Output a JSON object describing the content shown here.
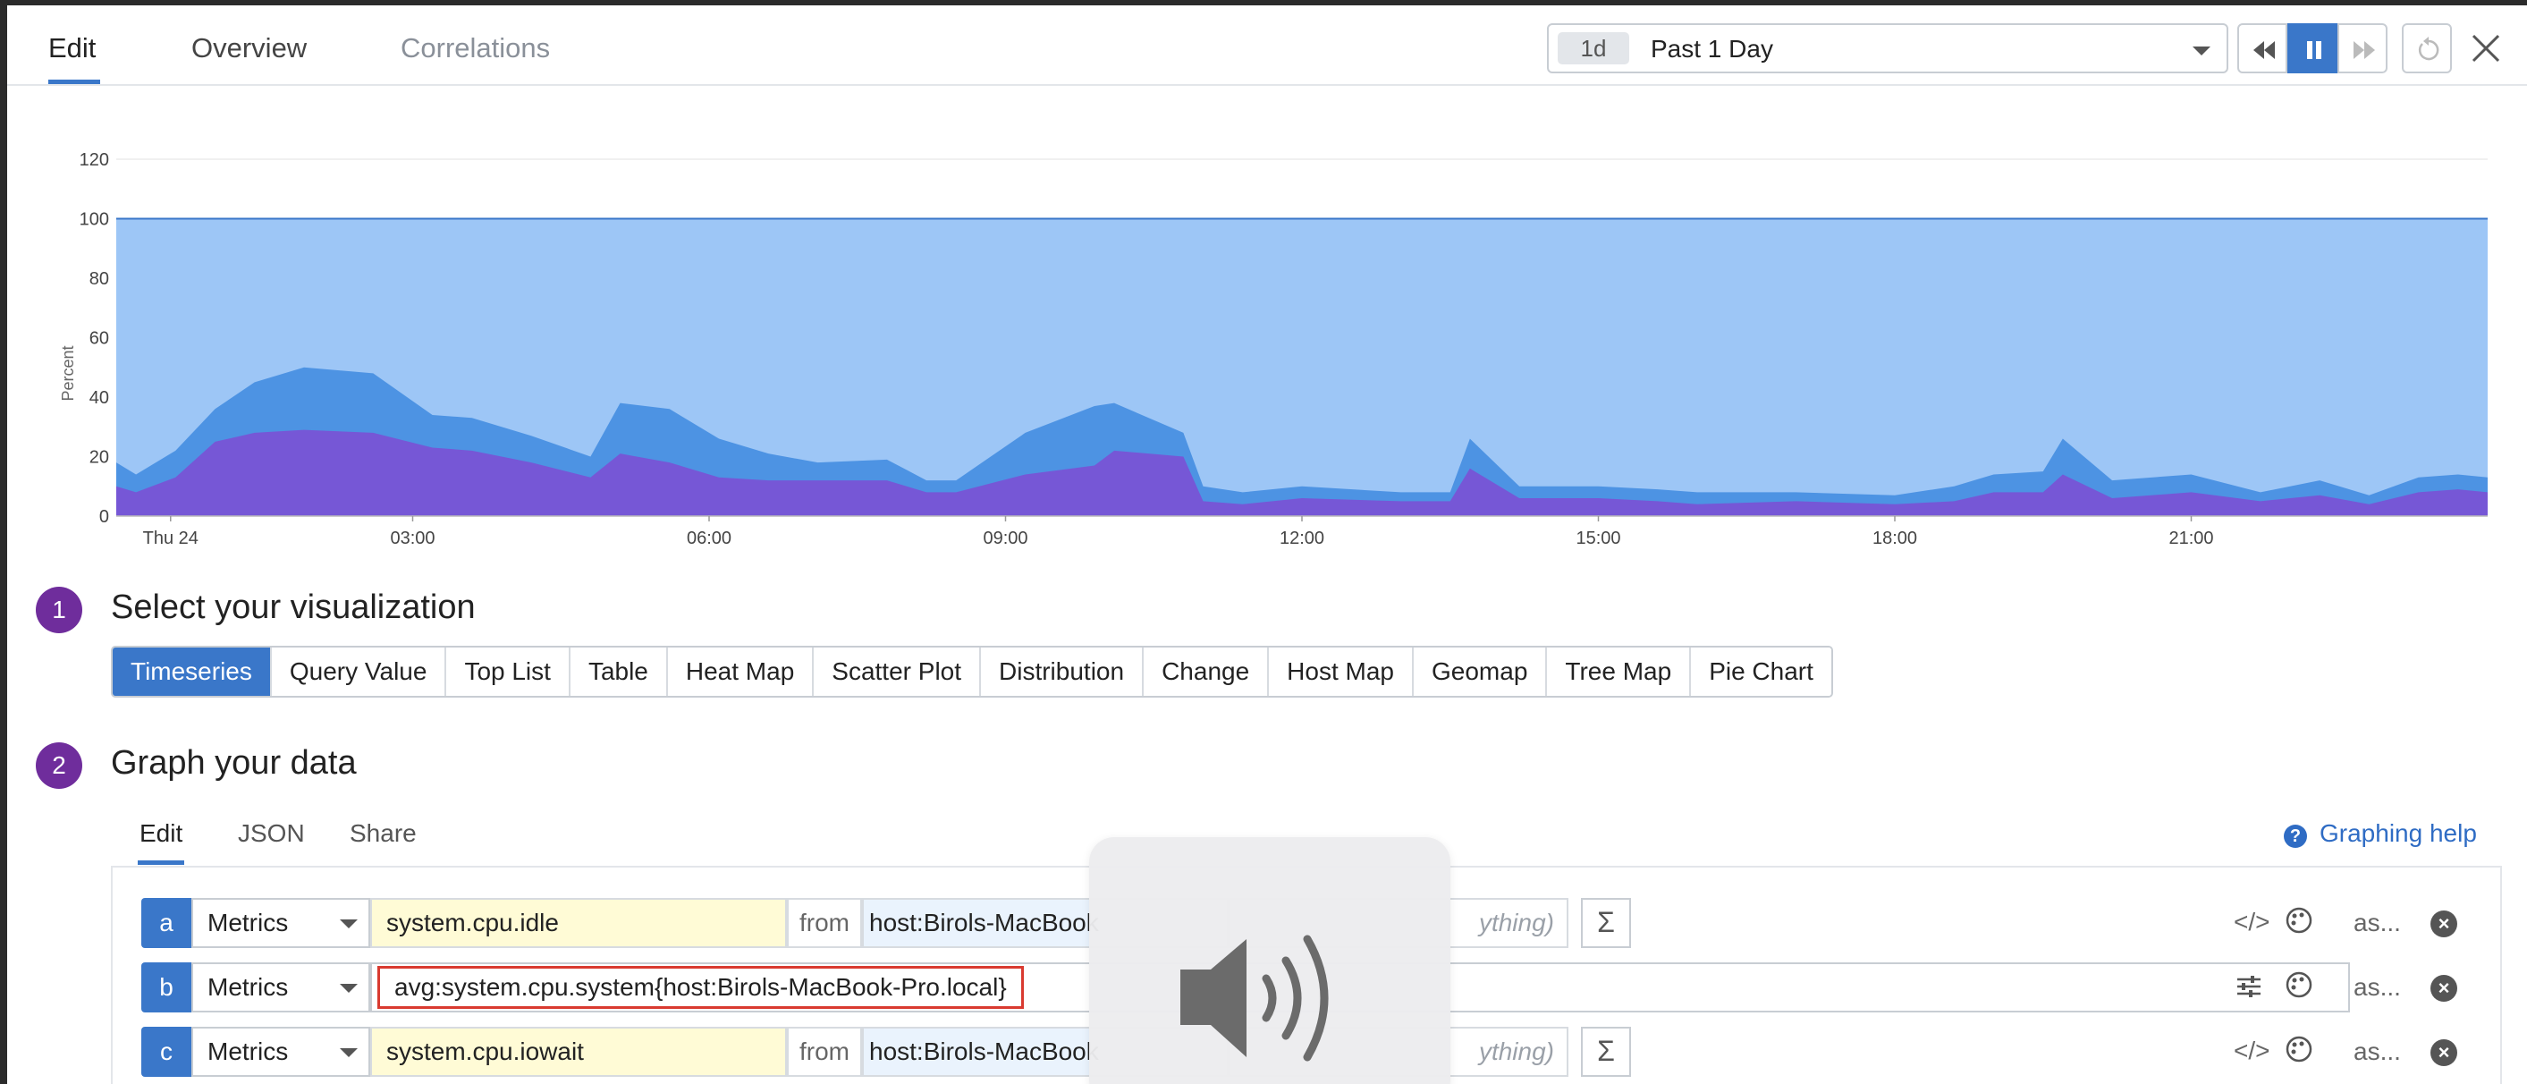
{
  "header": {
    "tabs": [
      {
        "label": "Edit",
        "active": true
      },
      {
        "label": "Overview",
        "active": false
      },
      {
        "label": "Correlations",
        "active": false
      }
    ],
    "timerange": {
      "badge": "1d",
      "label": "Past 1 Day"
    },
    "controls": [
      "rewind-icon",
      "pause-icon",
      "fast-forward-icon",
      "reset-icon",
      "close-icon"
    ]
  },
  "chart_data": {
    "type": "area",
    "ylabel": "Percent",
    "ylim": [
      0,
      120
    ],
    "yticks": [
      "0",
      "20",
      "40",
      "60",
      "80",
      "100",
      "120"
    ],
    "xticks": [
      "Thu 24",
      "03:00",
      "06:00",
      "09:00",
      "12:00",
      "15:00",
      "18:00",
      "21:00"
    ],
    "xlim_hours": [
      0,
      24
    ],
    "series": [
      {
        "color": "#9dc6f6",
        "values": [
          100,
          100,
          100,
          100,
          100,
          100,
          100,
          100,
          100,
          100,
          100,
          100,
          100,
          100,
          100,
          100,
          100,
          100,
          100,
          100,
          100,
          100,
          100,
          100
        ]
      },
      {
        "color": "#4d93e3",
        "x": [
          0,
          0.2,
          0.6,
          1.0,
          1.4,
          1.9,
          2.6,
          3.2,
          3.6,
          4.2,
          4.8,
          5.1,
          5.6,
          6.1,
          6.6,
          7.1,
          7.8,
          8.2,
          8.5,
          9.2,
          9.9,
          10.1,
          10.8,
          11.0,
          11.4,
          12.0,
          13.0,
          13.5,
          13.7,
          14.2,
          15.0,
          15.6,
          16.0,
          17.0,
          18.0,
          18.6,
          19.0,
          19.5,
          19.7,
          20.2,
          21.0,
          21.7,
          22.3,
          22.8,
          23.3,
          23.7,
          24.0
        ],
        "values": [
          18,
          14,
          22,
          36,
          45,
          50,
          48,
          34,
          33,
          27,
          20,
          38,
          36,
          26,
          21,
          18,
          19,
          12,
          12,
          28,
          37,
          38,
          28,
          10,
          8,
          10,
          8,
          8,
          26,
          10,
          10,
          9,
          8,
          8,
          7,
          10,
          14,
          15,
          26,
          12,
          14,
          8,
          12,
          7,
          13,
          14,
          13
        ]
      },
      {
        "color": "#7657d6",
        "x": [
          0,
          0.2,
          0.6,
          1.0,
          1.4,
          1.9,
          2.6,
          3.2,
          3.6,
          4.2,
          4.8,
          5.1,
          5.6,
          6.1,
          6.6,
          7.1,
          7.8,
          8.2,
          8.5,
          9.2,
          9.9,
          10.1,
          10.8,
          11.0,
          11.4,
          12.0,
          13.0,
          13.5,
          13.7,
          14.2,
          15.0,
          15.6,
          16.0,
          17.0,
          18.0,
          18.6,
          19.0,
          19.5,
          19.7,
          20.2,
          21.0,
          21.7,
          22.3,
          22.8,
          23.3,
          23.7,
          24.0
        ],
        "values": [
          10,
          8,
          13,
          25,
          28,
          29,
          28,
          23,
          22,
          18,
          13,
          21,
          18,
          13,
          12,
          12,
          12,
          8,
          8,
          14,
          17,
          22,
          20,
          5,
          4,
          6,
          5,
          5,
          16,
          6,
          6,
          5,
          4,
          5,
          4,
          5,
          8,
          8,
          14,
          6,
          8,
          5,
          7,
          4,
          8,
          9,
          8
        ]
      }
    ]
  },
  "visualization": {
    "step": "1",
    "title": "Select your visualization",
    "options": [
      "Timeseries",
      "Query Value",
      "Top List",
      "Table",
      "Heat Map",
      "Scatter Plot",
      "Distribution",
      "Change",
      "Host Map",
      "Geomap",
      "Tree Map",
      "Pie Chart"
    ],
    "selected": "Timeseries"
  },
  "graph": {
    "step": "2",
    "title": "Graph your data",
    "tabs": [
      "Edit",
      "JSON",
      "Share"
    ],
    "help": "Graphing help",
    "queries": [
      {
        "id": "a",
        "source": "Metrics",
        "metric": "system.cpu.idle",
        "from_label": "from",
        "host": "host:Birols-MacBook",
        "ghost": "ything)",
        "as": "as..."
      },
      {
        "id": "b",
        "source": "Metrics",
        "raw": "avg:system.cpu.system{host:Birols-MacBook-Pro.local}",
        "as": "as..."
      },
      {
        "id": "c",
        "source": "Metrics",
        "metric": "system.cpu.iowait",
        "from_label": "from",
        "host": "host:Birols-MacBook",
        "ghost": "ything)",
        "as": "as..."
      }
    ]
  },
  "overlay": {
    "icon": "volume-icon"
  }
}
